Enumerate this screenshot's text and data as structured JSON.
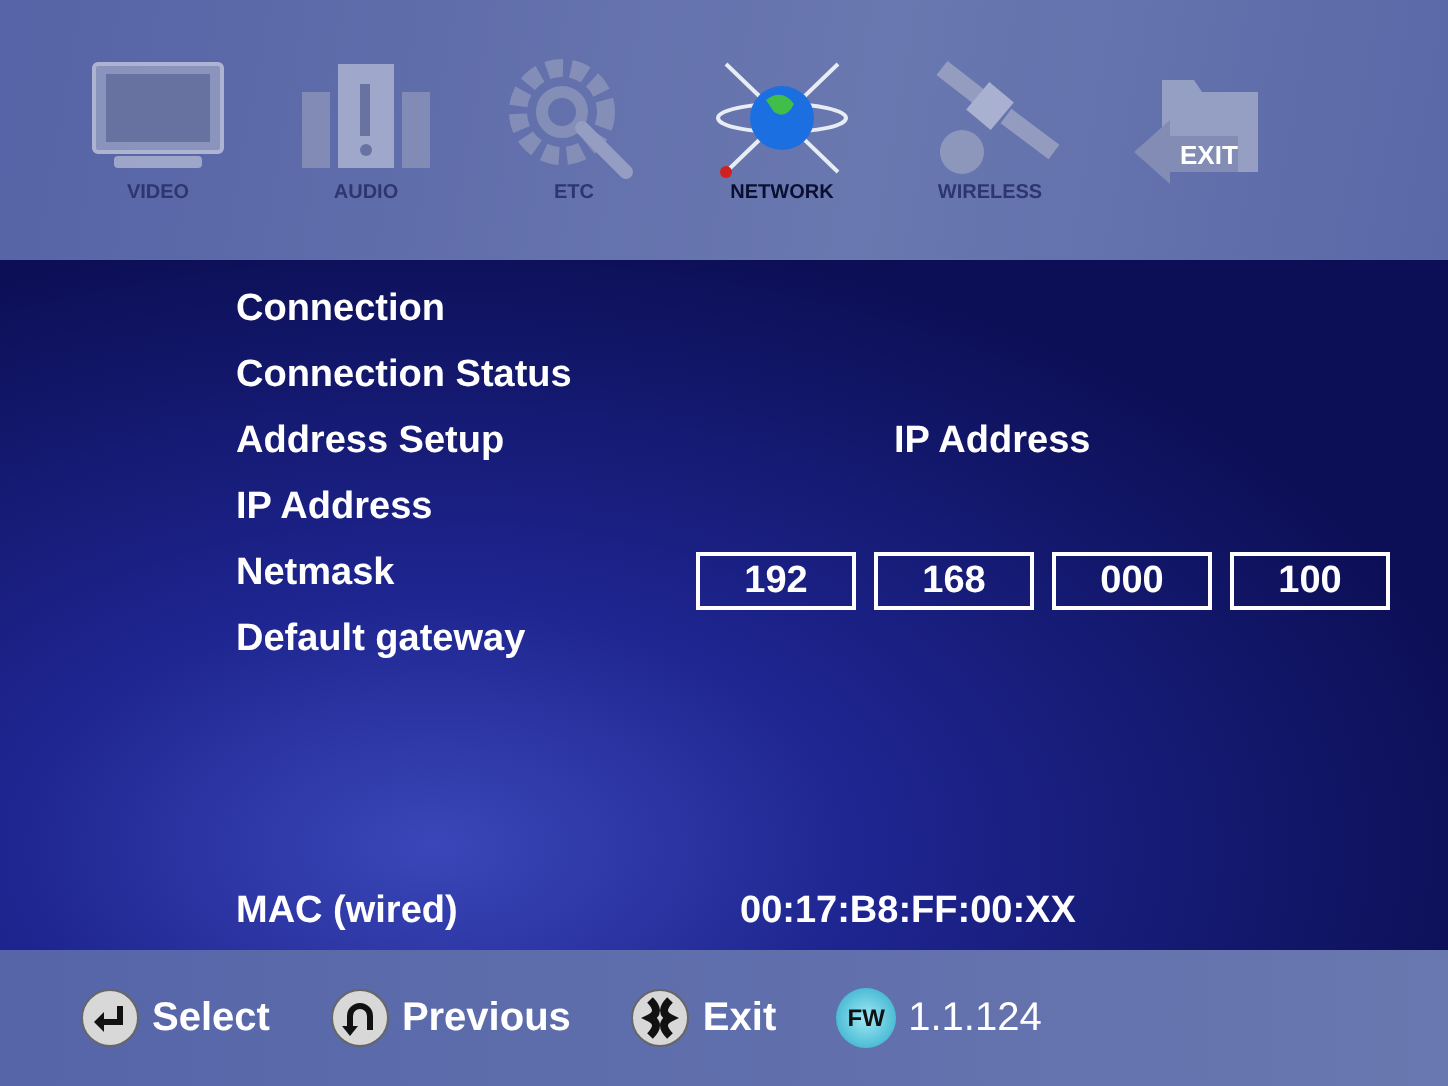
{
  "tabs": [
    {
      "kind": "tv",
      "label": "VIDEO",
      "selected": false
    },
    {
      "kind": "speakers",
      "label": "AUDIO",
      "selected": false
    },
    {
      "kind": "gear",
      "label": "ETC",
      "selected": false
    },
    {
      "kind": "globe",
      "label": "NETWORK",
      "selected": true
    },
    {
      "kind": "satellite",
      "label": "WIRELESS",
      "selected": false
    },
    {
      "kind": "folder",
      "label": "EXIT",
      "selected": false
    }
  ],
  "menu": {
    "items": [
      "Connection",
      "Connection Status",
      "Address Setup",
      "IP Address",
      "Netmask",
      "Default gateway"
    ]
  },
  "panel": {
    "heading": "IP Address",
    "fields": [
      "192",
      "168",
      "000",
      "100"
    ]
  },
  "mac": {
    "label": "MAC (wired)",
    "value": "00:17:B8:FF:00:XX"
  },
  "footer": {
    "hints": [
      {
        "kind": "enter",
        "label": "Select"
      },
      {
        "kind": "back",
        "label": "Previous"
      },
      {
        "kind": "tools",
        "label": "Exit"
      }
    ],
    "firmware": {
      "badge": "FW",
      "version": "1.1.124"
    }
  }
}
